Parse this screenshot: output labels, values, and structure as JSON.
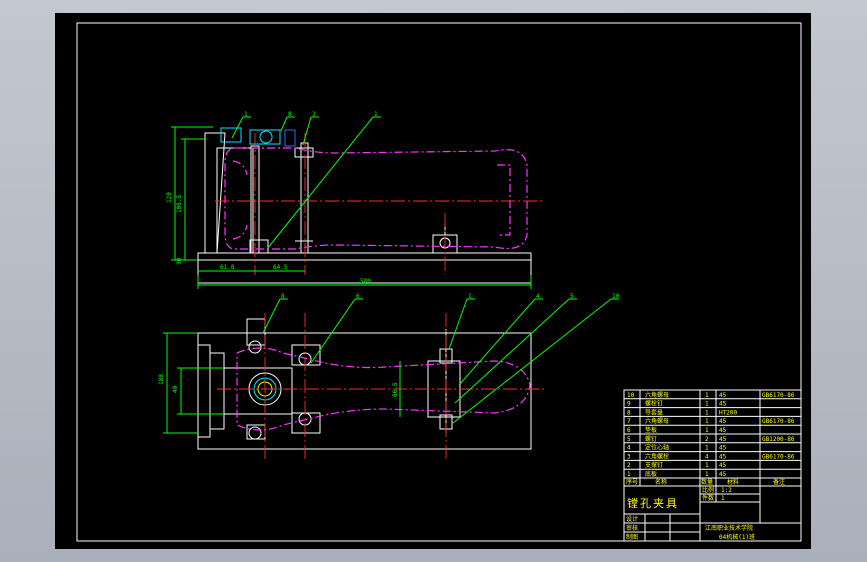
{
  "drawing": {
    "background": "#000000",
    "line_colors": {
      "outline": "#ffffff",
      "dimension": "#00ff00",
      "phantom_part": "#ff33ff",
      "center_line": "#ff2a2a",
      "text": "#ffff00"
    }
  },
  "dimensions": {
    "front_height_total": "120",
    "front_height_inner": "106.5",
    "base_thickness": "30",
    "left_offset": "61.8",
    "mid_offset": "64.5",
    "overall_length": "580",
    "top_view_height": "180",
    "top_view_inner": "40",
    "top_view_slot": "86.5"
  },
  "leader_labels": [
    "1",
    "8",
    "3",
    "1",
    "8",
    "6",
    "1",
    "4",
    "5",
    "10"
  ],
  "bom": {
    "rows": [
      {
        "no": "10",
        "name": "六角螺母",
        "qty": "1",
        "material": "45",
        "std": "GB6170-86"
      },
      {
        "no": "9",
        "name": "螺栓钉",
        "qty": "1",
        "material": "45",
        "std": ""
      },
      {
        "no": "8",
        "name": "导套盘",
        "qty": "1",
        "material": "HT200",
        "std": ""
      },
      {
        "no": "7",
        "name": "六角螺母",
        "qty": "1",
        "material": "45",
        "std": "GB6170-86"
      },
      {
        "no": "6",
        "name": "垫板",
        "qty": "1",
        "material": "45",
        "std": ""
      },
      {
        "no": "5",
        "name": "螺钉",
        "qty": "2",
        "material": "45",
        "std": "GB1200-86"
      },
      {
        "no": "4",
        "name": "定位心轴",
        "qty": "1",
        "material": "45",
        "std": ""
      },
      {
        "no": "3",
        "name": "六角螺栓",
        "qty": "4",
        "material": "45",
        "std": "GB6170-86"
      },
      {
        "no": "2",
        "name": "支撑钉",
        "qty": "1",
        "material": "45",
        "std": ""
      },
      {
        "no": "1",
        "name": "底板",
        "qty": "1",
        "material": "45",
        "std": ""
      }
    ],
    "header": {
      "no": "序号",
      "name": "名称",
      "qty": "数量",
      "material": "材料",
      "std": "备注"
    }
  },
  "title_block": {
    "title": "镗孔夹具",
    "scale_label": "比例",
    "scale": "1:2",
    "sheet_label": "件数",
    "sheet": "1",
    "designer_label": "设计",
    "checker_label": "审核",
    "drawer_label": "制图",
    "school": "江南职业技术学院",
    "class": "04机械(1)班"
  }
}
